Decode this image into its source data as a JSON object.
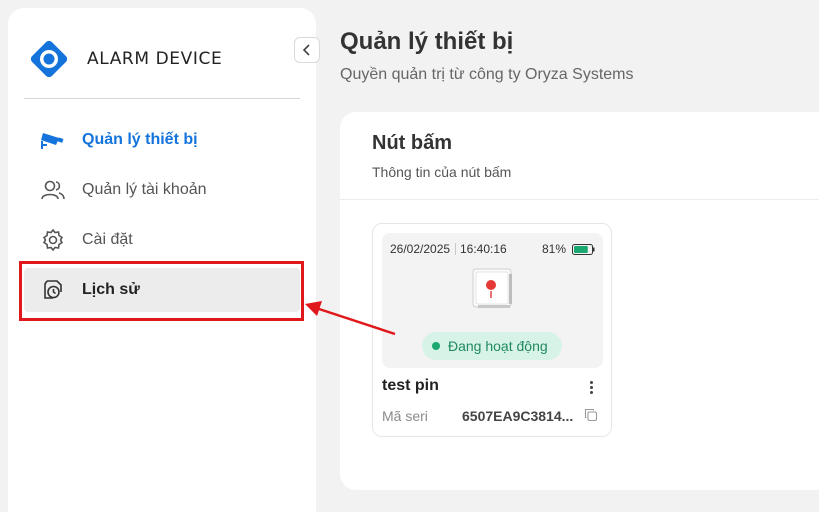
{
  "brand": {
    "name": "ALARM DEVICE",
    "accent": "#1474dc"
  },
  "sidebar": {
    "items": [
      {
        "label": "Quản lý thiết bị",
        "icon": "cctv-camera-icon",
        "state": "active"
      },
      {
        "label": "Quản lý tài khoản",
        "icon": "users-icon",
        "state": "normal"
      },
      {
        "label": "Cài đặt",
        "icon": "gear-icon",
        "state": "normal"
      },
      {
        "label": "Lịch sử",
        "icon": "history-clock-icon",
        "state": "hover"
      }
    ]
  },
  "header": {
    "title": "Quản lý thiết bị",
    "subtitle": "Quyền quản trị từ công ty Oryza Systems"
  },
  "panel": {
    "title": "Nút bấm",
    "subtitle": "Thông tin của nút bấm"
  },
  "device": {
    "date": "26/02/2025",
    "time": "16:40:16",
    "battery": "81%",
    "battery_level": 0.81,
    "status": "Đang hoạt động",
    "name": "test pin",
    "serial_label": "Mã seri",
    "serial_value": "6507EA9C3814..."
  },
  "colors": {
    "annotation": "#e0181b",
    "status_bg": "#d7f3e8",
    "status_text": "#1f8a5f",
    "battery": "#1aa870"
  }
}
